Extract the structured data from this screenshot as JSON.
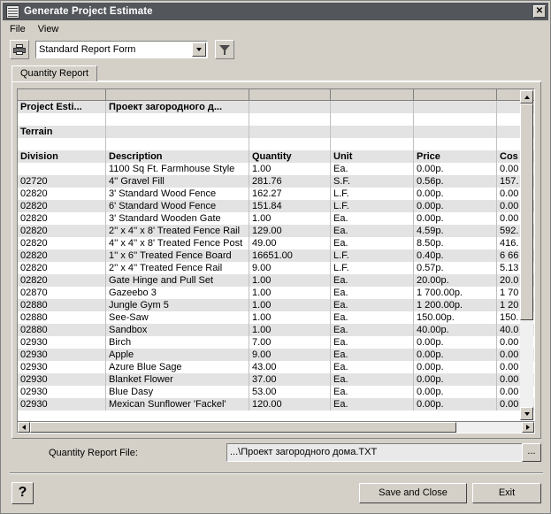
{
  "window": {
    "title": "Generate Project Estimate",
    "icon": "report-icon",
    "close_label": "✕"
  },
  "menubar": {
    "items": [
      {
        "label": "File"
      },
      {
        "label": "View"
      }
    ]
  },
  "toolbar": {
    "print_icon": "printer-icon",
    "report_form": "Standard Report Form",
    "filter_icon": "funnel-icon"
  },
  "tabs": [
    {
      "label": "Quantity Report",
      "selected": true
    }
  ],
  "grid": {
    "meta_rows": [
      {
        "label": "Project Esti...",
        "value": "Проект загородного д..."
      },
      {
        "label": "",
        "value": ""
      },
      {
        "label": "Terrain",
        "value": ""
      },
      {
        "label": "",
        "value": ""
      }
    ],
    "columns": [
      "Division",
      "Description",
      "Quantity",
      "Unit",
      "Price",
      "Cos"
    ],
    "rows": [
      {
        "division": "",
        "description": "1100 Sq Ft. Farmhouse Style",
        "quantity": "1.00",
        "unit": "Ea.",
        "price": "0.00р.",
        "cost": "0.00"
      },
      {
        "division": "02720",
        "description": "4'' Gravel Fill",
        "quantity": "281.76",
        "unit": "S.F.",
        "price": "0.56р.",
        "cost": "157."
      },
      {
        "division": "02820",
        "description": "3' Standard Wood Fence",
        "quantity": "162.27",
        "unit": "L.F.",
        "price": "0.00р.",
        "cost": "0.00"
      },
      {
        "division": "02820",
        "description": "6' Standard Wood Fence",
        "quantity": "151.84",
        "unit": "L.F.",
        "price": "0.00р.",
        "cost": "0.00"
      },
      {
        "division": "02820",
        "description": "3' Standard Wooden Gate",
        "quantity": "1.00",
        "unit": "Ea.",
        "price": "0.00р.",
        "cost": "0.00"
      },
      {
        "division": "02820",
        "description": "2'' x 4'' x 8' Treated Fence Rail",
        "quantity": "129.00",
        "unit": "Ea.",
        "price": "4.59р.",
        "cost": "592."
      },
      {
        "division": "02820",
        "description": "4'' x 4'' x 8' Treated Fence Post",
        "quantity": "49.00",
        "unit": "Ea.",
        "price": "8.50р.",
        "cost": "416."
      },
      {
        "division": "02820",
        "description": "1'' x 6'' Treated Fence Board",
        "quantity": "16651.00",
        "unit": "L.F.",
        "price": "0.40р.",
        "cost": "6 66"
      },
      {
        "division": "02820",
        "description": "2'' x 4'' Treated Fence Rail",
        "quantity": "9.00",
        "unit": "L.F.",
        "price": "0.57р.",
        "cost": "5.13"
      },
      {
        "division": "02820",
        "description": "Gate Hinge and Pull Set",
        "quantity": "1.00",
        "unit": "Ea.",
        "price": "20.00р.",
        "cost": "20.0"
      },
      {
        "division": "02870",
        "description": "Gazeebo 3",
        "quantity": "1.00",
        "unit": "Ea.",
        "price": "1 700.00р.",
        "cost": "1 70"
      },
      {
        "division": "02880",
        "description": "Jungle Gym 5",
        "quantity": "1.00",
        "unit": "Ea.",
        "price": "1 200.00р.",
        "cost": "1 20"
      },
      {
        "division": "02880",
        "description": "See-Saw",
        "quantity": "1.00",
        "unit": "Ea.",
        "price": "150.00р.",
        "cost": "150."
      },
      {
        "division": "02880",
        "description": "Sandbox",
        "quantity": "1.00",
        "unit": "Ea.",
        "price": "40.00р.",
        "cost": "40.0"
      },
      {
        "division": "02930",
        "description": "Birch",
        "quantity": "7.00",
        "unit": "Ea.",
        "price": "0.00р.",
        "cost": "0.00"
      },
      {
        "division": "02930",
        "description": "Apple",
        "quantity": "9.00",
        "unit": "Ea.",
        "price": "0.00р.",
        "cost": "0.00"
      },
      {
        "division": "02930",
        "description": "Azure Blue Sage",
        "quantity": "43.00",
        "unit": "Ea.",
        "price": "0.00р.",
        "cost": "0.00"
      },
      {
        "division": "02930",
        "description": "Blanket Flower",
        "quantity": "37.00",
        "unit": "Ea.",
        "price": "0.00р.",
        "cost": "0.00"
      },
      {
        "division": "02930",
        "description": "Blue Dasy",
        "quantity": "53.00",
        "unit": "Ea.",
        "price": "0.00р.",
        "cost": "0.00"
      },
      {
        "division": "02930",
        "description": "Mexican Sunflower 'Fackel'",
        "quantity": "120.00",
        "unit": "Ea.",
        "price": "0.00р.",
        "cost": "0.00"
      }
    ]
  },
  "file_row": {
    "label": "Quantity Report File:",
    "value": "...\\Проект загородного дома.TXT",
    "browse_label": "..."
  },
  "footer": {
    "help_label": "?",
    "save_label": "Save and Close",
    "exit_label": "Exit"
  },
  "colors": {
    "titlebar": "#53565b",
    "face": "#d4d0c8",
    "band": "#e3e3e3"
  }
}
